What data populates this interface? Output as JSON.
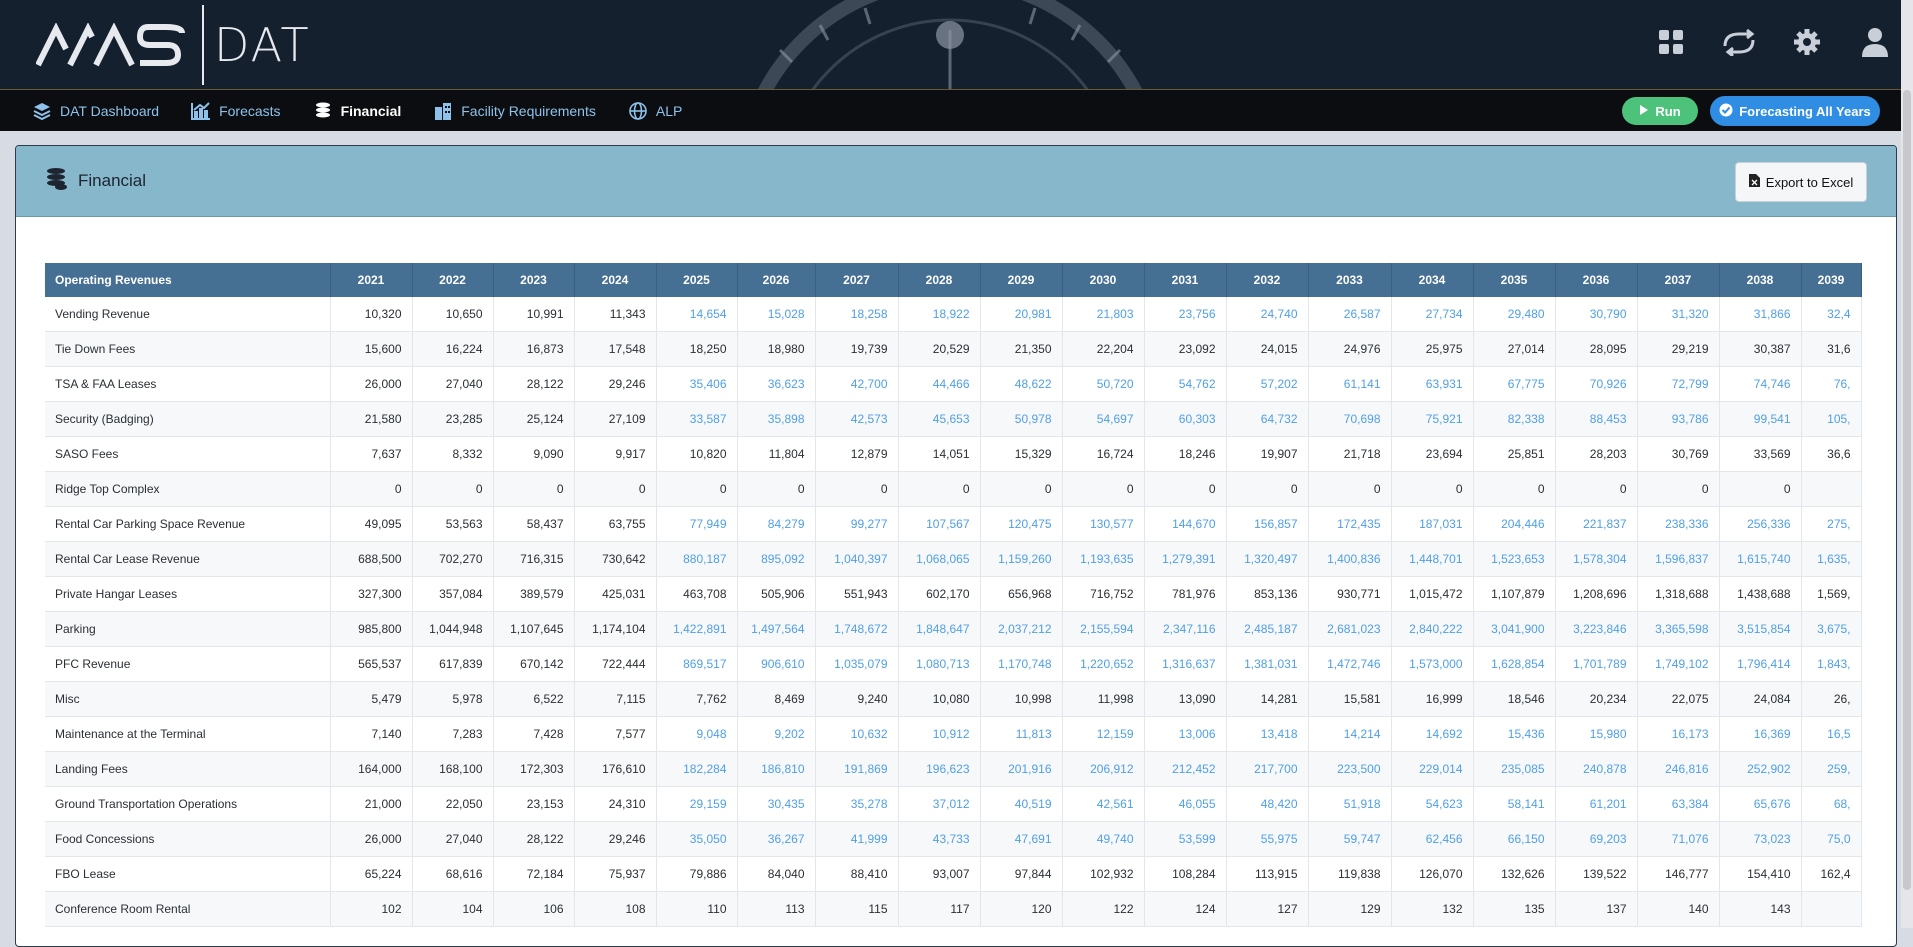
{
  "app": {
    "logo_text": "NAS",
    "product": "DAT"
  },
  "top_icons": [
    {
      "name": "apps-grid-icon"
    },
    {
      "name": "switch-airport-icon"
    },
    {
      "name": "settings-gear-icon"
    },
    {
      "name": "user-profile-icon"
    }
  ],
  "nav": {
    "items": [
      {
        "label": "DAT Dashboard",
        "icon": "layers-icon",
        "active": false
      },
      {
        "label": "Forecasts",
        "icon": "chart-icon",
        "active": false
      },
      {
        "label": "Financial",
        "icon": "coins-icon",
        "active": true
      },
      {
        "label": "Facility Requirements",
        "icon": "building-icon",
        "active": false
      },
      {
        "label": "ALP",
        "icon": "globe-icon",
        "active": false
      }
    ],
    "run_label": "Run",
    "forecast_label": "Forecasting All Years"
  },
  "card": {
    "title": "Financial",
    "export_label": "Export to Excel"
  },
  "table": {
    "header_label": "Operating Revenues",
    "years": [
      "2021",
      "2022",
      "2023",
      "2024",
      "2025",
      "2026",
      "2027",
      "2028",
      "2029",
      "2030",
      "2031",
      "2032",
      "2033",
      "2034",
      "2035",
      "2036",
      "2037",
      "2038",
      "2039"
    ],
    "rows": [
      {
        "label": "Vending Revenue",
        "forecast": true,
        "values": [
          "10,320",
          "10,650",
          "10,991",
          "11,343",
          "14,654",
          "15,028",
          "18,258",
          "18,922",
          "20,981",
          "21,803",
          "23,756",
          "24,740",
          "26,587",
          "27,734",
          "29,480",
          "30,790",
          "31,320",
          "31,866",
          "32,4"
        ]
      },
      {
        "label": "Tie Down Fees",
        "forecast": false,
        "values": [
          "15,600",
          "16,224",
          "16,873",
          "17,548",
          "18,250",
          "18,980",
          "19,739",
          "20,529",
          "21,350",
          "22,204",
          "23,092",
          "24,015",
          "24,976",
          "25,975",
          "27,014",
          "28,095",
          "29,219",
          "30,387",
          "31,6"
        ]
      },
      {
        "label": "TSA & FAA Leases",
        "forecast": true,
        "values": [
          "26,000",
          "27,040",
          "28,122",
          "29,246",
          "35,406",
          "36,623",
          "42,700",
          "44,466",
          "48,622",
          "50,720",
          "54,762",
          "57,202",
          "61,141",
          "63,931",
          "67,775",
          "70,926",
          "72,799",
          "74,746",
          "76,"
        ]
      },
      {
        "label": "Security (Badging)",
        "forecast": true,
        "values": [
          "21,580",
          "23,285",
          "25,124",
          "27,109",
          "33,587",
          "35,898",
          "42,573",
          "45,653",
          "50,978",
          "54,697",
          "60,303",
          "64,732",
          "70,698",
          "75,921",
          "82,338",
          "88,453",
          "93,786",
          "99,541",
          "105,"
        ]
      },
      {
        "label": "SASO Fees",
        "forecast": false,
        "values": [
          "7,637",
          "8,332",
          "9,090",
          "9,917",
          "10,820",
          "11,804",
          "12,879",
          "14,051",
          "15,329",
          "16,724",
          "18,246",
          "19,907",
          "21,718",
          "23,694",
          "25,851",
          "28,203",
          "30,769",
          "33,569",
          "36,6"
        ]
      },
      {
        "label": "Ridge Top Complex",
        "forecast": false,
        "values": [
          "0",
          "0",
          "0",
          "0",
          "0",
          "0",
          "0",
          "0",
          "0",
          "0",
          "0",
          "0",
          "0",
          "0",
          "0",
          "0",
          "0",
          "0",
          ""
        ]
      },
      {
        "label": "Rental Car Parking Space Revenue",
        "forecast": true,
        "values": [
          "49,095",
          "53,563",
          "58,437",
          "63,755",
          "77,949",
          "84,279",
          "99,277",
          "107,567",
          "120,475",
          "130,577",
          "144,670",
          "156,857",
          "172,435",
          "187,031",
          "204,446",
          "221,837",
          "238,336",
          "256,336",
          "275,"
        ]
      },
      {
        "label": "Rental Car Lease Revenue",
        "forecast": true,
        "values": [
          "688,500",
          "702,270",
          "716,315",
          "730,642",
          "880,187",
          "895,092",
          "1,040,397",
          "1,068,065",
          "1,159,260",
          "1,193,635",
          "1,279,391",
          "1,320,497",
          "1,400,836",
          "1,448,701",
          "1,523,653",
          "1,578,304",
          "1,596,837",
          "1,615,740",
          "1,635,"
        ]
      },
      {
        "label": "Private Hangar Leases",
        "forecast": false,
        "values": [
          "327,300",
          "357,084",
          "389,579",
          "425,031",
          "463,708",
          "505,906",
          "551,943",
          "602,170",
          "656,968",
          "716,752",
          "781,976",
          "853,136",
          "930,771",
          "1,015,472",
          "1,107,879",
          "1,208,696",
          "1,318,688",
          "1,438,688",
          "1,569,"
        ]
      },
      {
        "label": "Parking",
        "forecast": true,
        "values": [
          "985,800",
          "1,044,948",
          "1,107,645",
          "1,174,104",
          "1,422,891",
          "1,497,564",
          "1,748,672",
          "1,848,647",
          "2,037,212",
          "2,155,594",
          "2,347,116",
          "2,485,187",
          "2,681,023",
          "2,840,222",
          "3,041,900",
          "3,223,846",
          "3,365,598",
          "3,515,854",
          "3,675,"
        ]
      },
      {
        "label": "PFC Revenue",
        "forecast": true,
        "values": [
          "565,537",
          "617,839",
          "670,142",
          "722,444",
          "869,517",
          "906,610",
          "1,035,079",
          "1,080,713",
          "1,170,748",
          "1,220,652",
          "1,316,637",
          "1,381,031",
          "1,472,746",
          "1,573,000",
          "1,628,854",
          "1,701,789",
          "1,749,102",
          "1,796,414",
          "1,843,"
        ]
      },
      {
        "label": "Misc",
        "forecast": false,
        "values": [
          "5,479",
          "5,978",
          "6,522",
          "7,115",
          "7,762",
          "8,469",
          "9,240",
          "10,080",
          "10,998",
          "11,998",
          "13,090",
          "14,281",
          "15,581",
          "16,999",
          "18,546",
          "20,234",
          "22,075",
          "24,084",
          "26,"
        ]
      },
      {
        "label": "Maintenance at the Terminal",
        "forecast": true,
        "values": [
          "7,140",
          "7,283",
          "7,428",
          "7,577",
          "9,048",
          "9,202",
          "10,632",
          "10,912",
          "11,813",
          "12,159",
          "13,006",
          "13,418",
          "14,214",
          "14,692",
          "15,436",
          "15,980",
          "16,173",
          "16,369",
          "16,5"
        ]
      },
      {
        "label": "Landing Fees",
        "forecast": true,
        "values": [
          "164,000",
          "168,100",
          "172,303",
          "176,610",
          "182,284",
          "186,810",
          "191,869",
          "196,623",
          "201,916",
          "206,912",
          "212,452",
          "217,700",
          "223,500",
          "229,014",
          "235,085",
          "240,878",
          "246,816",
          "252,902",
          "259,"
        ]
      },
      {
        "label": "Ground Transportation Operations",
        "forecast": true,
        "values": [
          "21,000",
          "22,050",
          "23,153",
          "24,310",
          "29,159",
          "30,435",
          "35,278",
          "37,012",
          "40,519",
          "42,561",
          "46,055",
          "48,420",
          "51,918",
          "54,623",
          "58,141",
          "61,201",
          "63,384",
          "65,676",
          "68,"
        ]
      },
      {
        "label": "Food Concessions",
        "forecast": true,
        "values": [
          "26,000",
          "27,040",
          "28,122",
          "29,246",
          "35,050",
          "36,267",
          "41,999",
          "43,733",
          "47,691",
          "49,740",
          "53,599",
          "55,975",
          "59,747",
          "62,456",
          "66,150",
          "69,203",
          "71,076",
          "73,023",
          "75,0"
        ]
      },
      {
        "label": "FBO Lease",
        "forecast": false,
        "values": [
          "65,224",
          "68,616",
          "72,184",
          "75,937",
          "79,886",
          "84,040",
          "88,410",
          "93,007",
          "97,844",
          "102,932",
          "108,284",
          "113,915",
          "119,838",
          "126,070",
          "132,626",
          "139,522",
          "146,777",
          "154,410",
          "162,4"
        ]
      },
      {
        "label": "Conference Room Rental",
        "forecast": false,
        "values": [
          "102",
          "104",
          "106",
          "108",
          "110",
          "113",
          "115",
          "117",
          "120",
          "122",
          "124",
          "127",
          "129",
          "132",
          "135",
          "137",
          "140",
          "143",
          ""
        ]
      }
    ]
  },
  "colors": {
    "topbar": "#15202f",
    "navbar": "#0b0d10",
    "header_row": "#456f93",
    "card_header": "#86b7ca",
    "forecast_text": "#4f9fe6",
    "run": "#4cc27a",
    "forecast_button": "#2f8de4"
  }
}
